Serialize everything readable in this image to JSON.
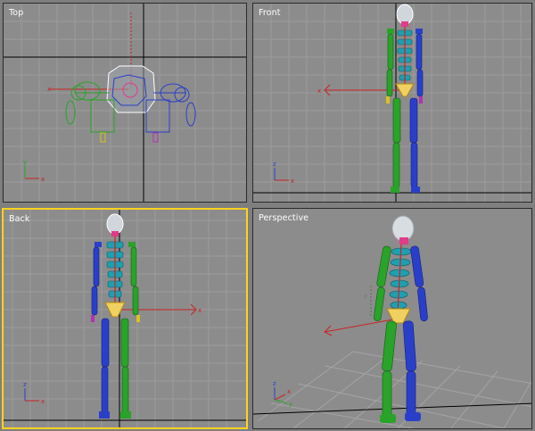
{
  "viewports": {
    "top": {
      "label": "Top"
    },
    "front": {
      "label": "Front"
    },
    "back": {
      "label": "Back"
    },
    "perspective": {
      "label": "Perspective"
    }
  },
  "axis_tripod": {
    "x": "x",
    "y": "y",
    "z": "z"
  },
  "colors": {
    "viewport_bg": "#8c8c8c",
    "grid": "#9a9a9a",
    "grid_major": "#000000",
    "active_border": "#ffd21e",
    "bone_green": "#29a329",
    "bone_blue": "#2a3fc9",
    "bone_cyan": "#1f9fb0",
    "bone_red": "#cc2222",
    "head": "#c8cfd6"
  }
}
